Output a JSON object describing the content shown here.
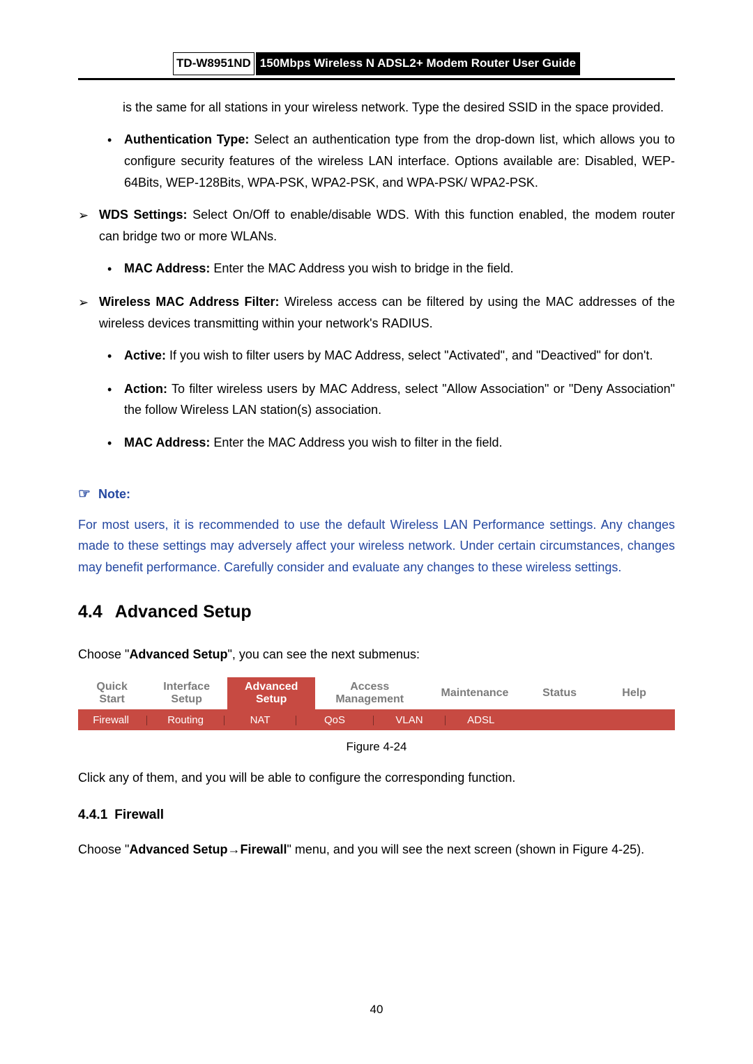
{
  "header": {
    "model": "TD-W8951ND",
    "title": "150Mbps Wireless N ADSL2+ Modem Router User Guide"
  },
  "continuation": "is the same for all stations in your wireless network. Type the desired SSID in the space provided.",
  "auth": {
    "label": "Authentication Type:",
    "text": " Select an authentication type from the drop-down list, which allows you to configure security features of the wireless LAN interface. Options available are: Disabled, WEP-64Bits, WEP-128Bits, WPA-PSK, WPA2-PSK, and WPA-PSK/ WPA2-PSK."
  },
  "wds": {
    "label": "WDS Settings:",
    "text": " Select On/Off to enable/disable WDS. With this function enabled, the modem router can bridge two or more WLANs.",
    "mac_label": "MAC Address:",
    "mac_text": " Enter the MAC Address you wish to bridge in the field."
  },
  "macfilter": {
    "label": "Wireless MAC Address Filter:",
    "text": " Wireless access can be filtered by using the MAC addresses of the wireless devices transmitting within your network's RADIUS.",
    "active_label": "Active:",
    "active_text": " If you wish to filter users by MAC Address, select \"Activated\", and \"Deactived\" for don't.",
    "action_label": "Action:",
    "action_text": " To filter wireless users by MAC Address, select \"Allow Association\" or \"Deny Association\" the follow Wireless LAN station(s) association.",
    "mac_label": "MAC Address:",
    "mac_text": " Enter the MAC Address you wish to filter in the field."
  },
  "note": {
    "label": "Note:",
    "body": "For most users, it is recommended to use the default Wireless LAN Performance settings. Any changes made to these settings may adversely affect your wireless network. Under certain circumstances, changes may benefit performance. Carefully consider and evaluate any changes to these wireless settings."
  },
  "section": {
    "num": "4.4",
    "title": "Advanced Setup",
    "intro_pre": "Choose \"",
    "intro_bold": "Advanced Setup",
    "intro_post": "\", you can see the next submenus:",
    "after_figure": "Click any of them, and you will be able to configure the corresponding function."
  },
  "menu": {
    "top": [
      "Quick\nStart",
      "Interface\nSetup",
      "Advanced\nSetup",
      "Access\nManagement",
      "Maintenance",
      "Status",
      "Help"
    ],
    "active_index": 2,
    "bottom": [
      "Firewall",
      "Routing",
      "NAT",
      "QoS",
      "VLAN",
      "ADSL"
    ]
  },
  "figure_caption": "Figure 4-24",
  "subsection": {
    "num": "4.4.1",
    "title": "Firewall",
    "pre": "Choose \"",
    "bold": "Advanced Setup→Firewall",
    "post": "\" menu, and you will see the next screen (shown in Figure 4-25)."
  },
  "page_num": "40"
}
